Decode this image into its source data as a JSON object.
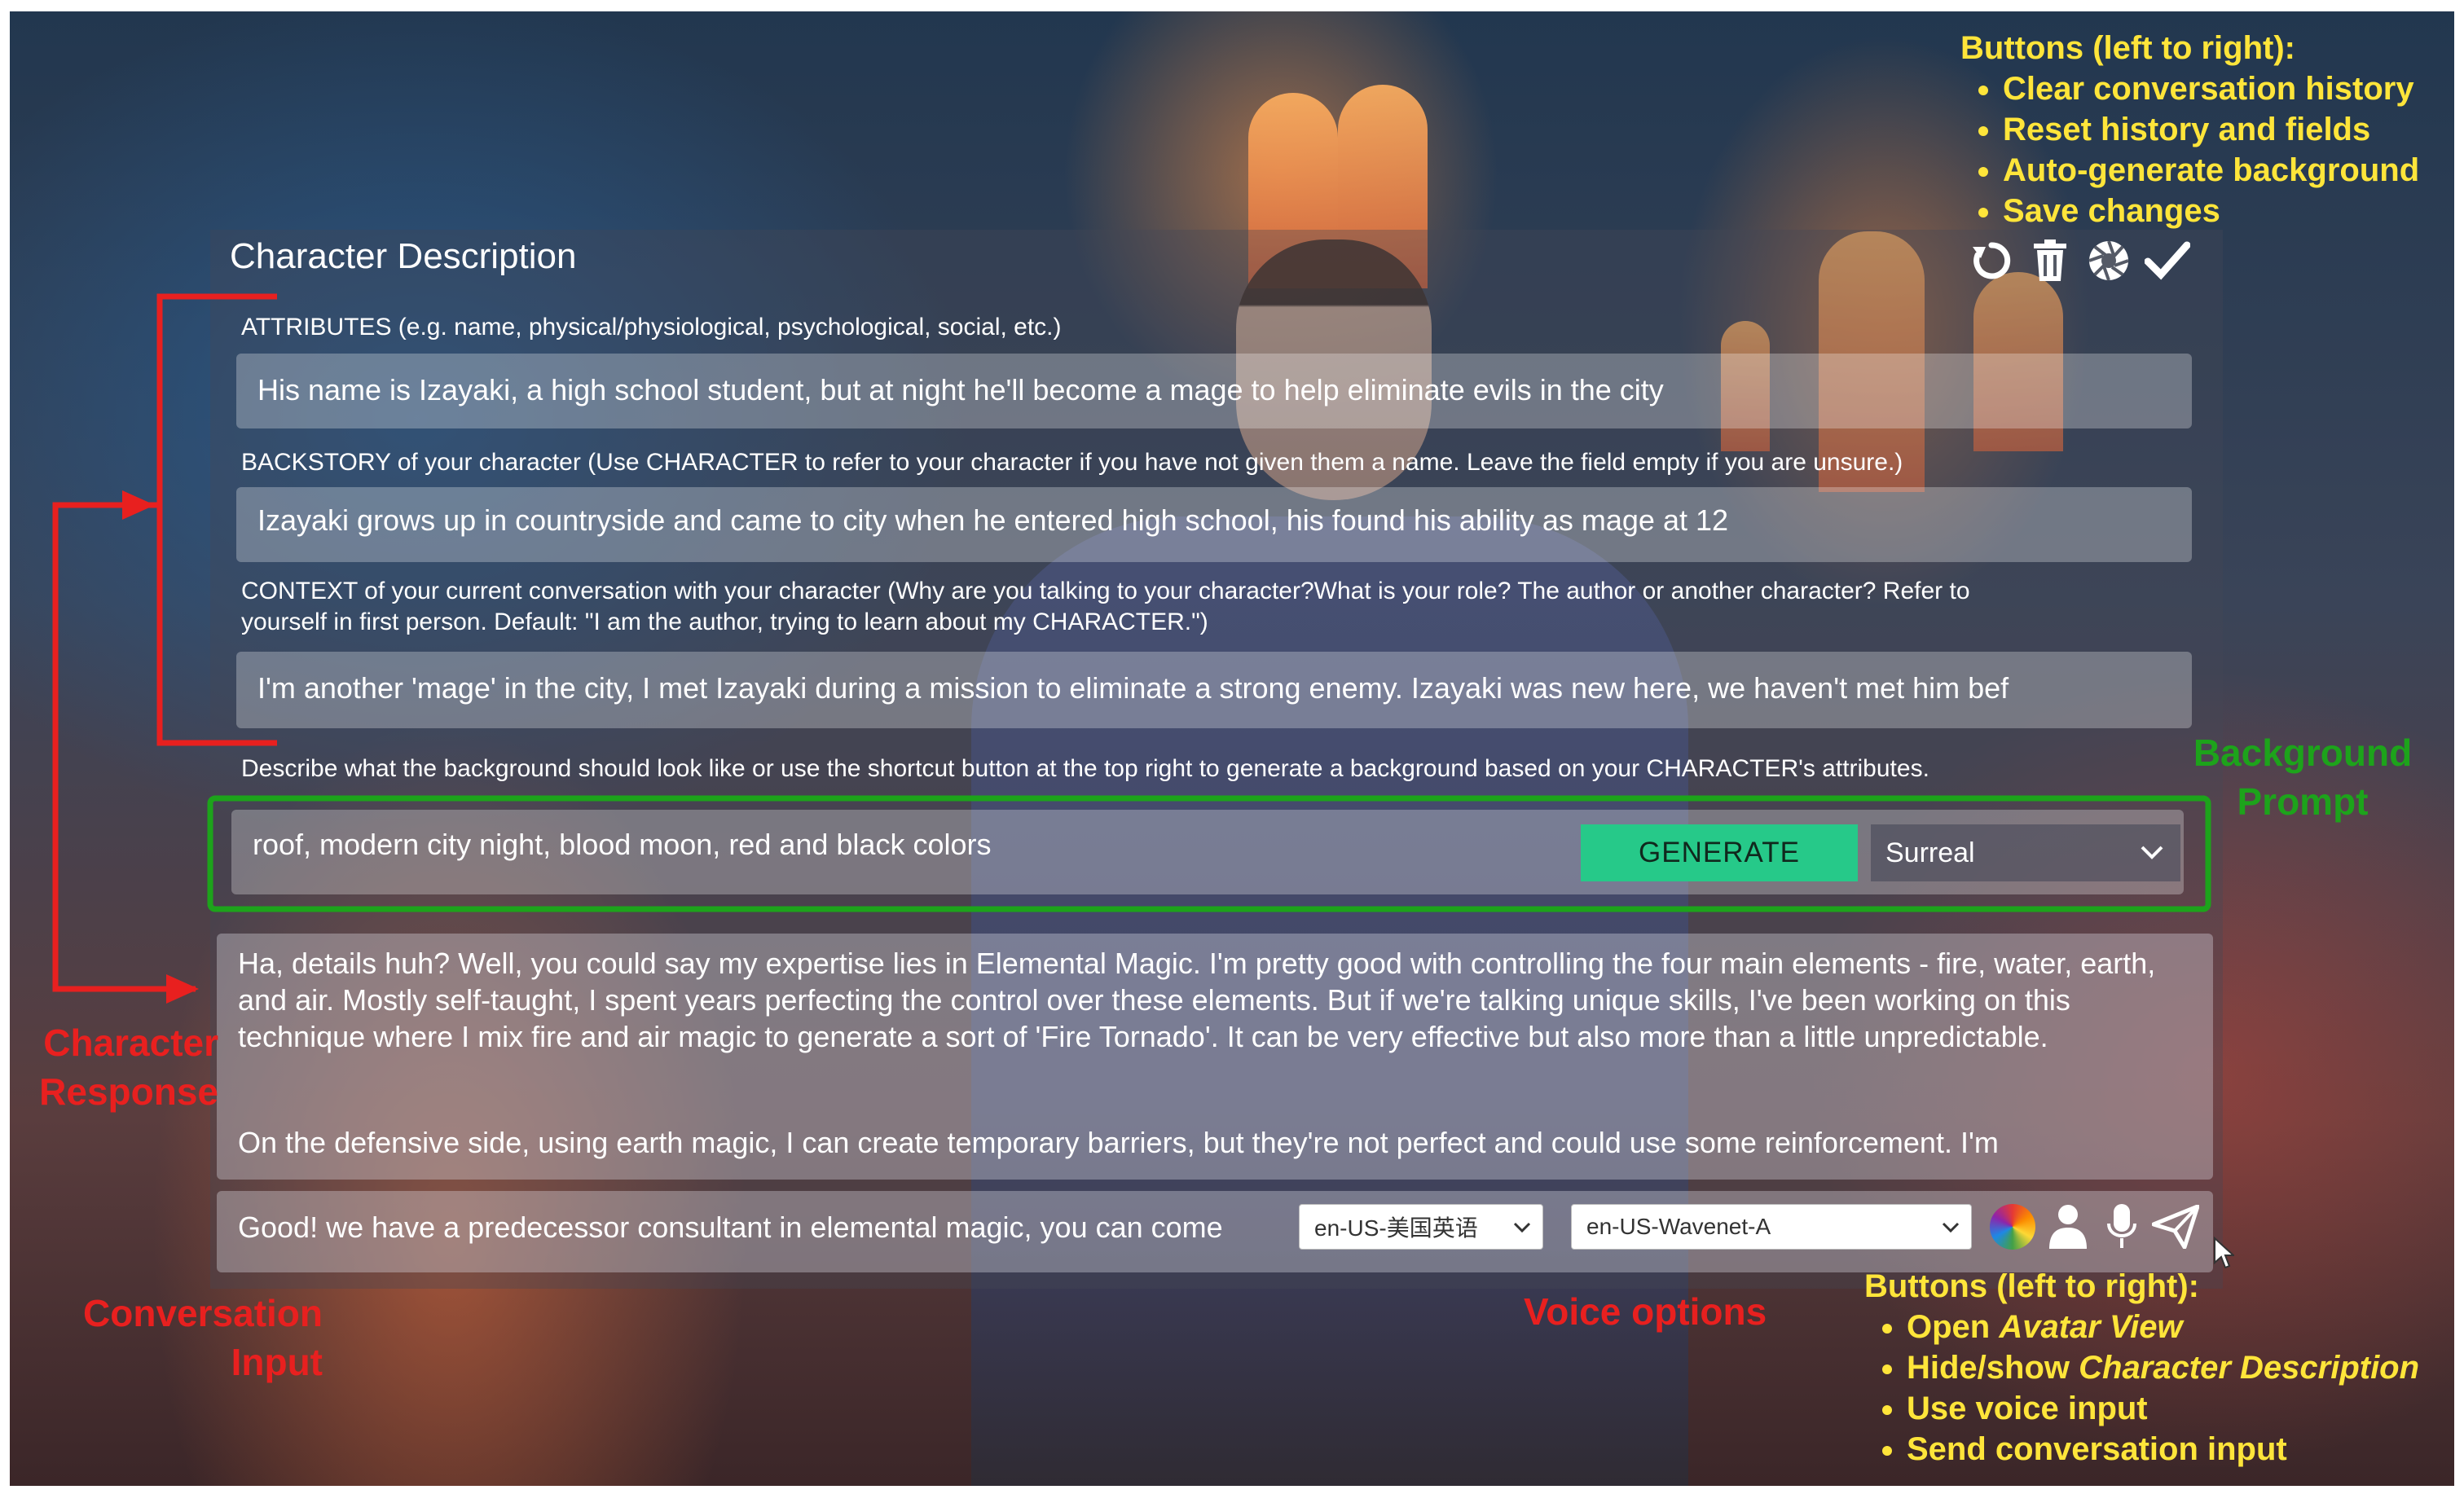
{
  "panel": {
    "title": "Character Description"
  },
  "toolbar": {
    "icons": [
      "clear-conversation-icon",
      "reset-trash-icon",
      "auto-generate-background-icon",
      "save-check-icon"
    ]
  },
  "attributes": {
    "label": "ATTRIBUTES (e.g. name, physical/physiological, psychological, social, etc.)",
    "value": "His name is Izayaki, a high school student, but at night he'll become a mage to help eliminate evils in the city"
  },
  "backstory": {
    "label": "BACKSTORY of your character (Use CHARACTER to refer to your character if you have not given them a name. Leave the field empty if you are unsure.)",
    "value": "Izayaki grows up in countryside and came to city when he entered high school, his found his ability as mage at 12"
  },
  "context": {
    "label_line1": "CONTEXT of your current conversation with your character (Why are you talking to your character?What is your role? The author or another character? Refer to",
    "label_line2": "yourself in first person. Default: \"I am the author, trying to learn about my CHARACTER.\")",
    "value": "I'm another 'mage' in the city, I met Izayaki during a mission to eliminate a strong enemy. Izayaki was new here, we haven't met him bef"
  },
  "background": {
    "label": "Describe what the background should look like or use the shortcut button at the top right to generate a background based on your CHARACTER's attributes.",
    "prompt": "roof, modern city night, blood moon, red and black colors",
    "generate_label": "GENERATE",
    "style_value": "Surreal"
  },
  "response": {
    "paragraph1": "Ha, details huh? Well, you could say my expertise lies in Elemental Magic. I'm pretty good with controlling the four main elements - fire, water, earth, and air. Mostly self-taught, I spent years perfecting the control over these elements. But if we're talking unique skills, I've been working on this technique where I mix fire and air magic to generate a sort of 'Fire Tornado'. It can be very effective but also more than a little unpredictable.",
    "paragraph2": "On the defensive side, using earth magic, I can create temporary barriers, but they're not perfect and could use some reinforcement. I'm"
  },
  "conversation_input": {
    "value": "Good! we have a predecessor consultant in elemental magic, you can come",
    "language_value": "en-US-美国英语",
    "voice_value": "en-US-Wavenet-A",
    "icons": [
      "color-wheel-icon",
      "person-icon",
      "microphone-icon",
      "send-icon"
    ]
  },
  "annotations": {
    "top_buttons": {
      "heading": "Buttons (left to right):",
      "items": [
        "Clear conversation history",
        "Reset history and fields",
        "Auto-generate background",
        "Save changes"
      ]
    },
    "bottom_buttons": {
      "heading": "Buttons (left to right):",
      "items": [
        {
          "prefix": "Open ",
          "emph": "Avatar View"
        },
        {
          "prefix": "Hide/show ",
          "emph": "Character Description"
        },
        {
          "prefix": "Use voice input",
          "emph": ""
        },
        {
          "prefix": "Send conversation input",
          "emph": ""
        }
      ]
    },
    "background_prompt": [
      "Background",
      "Prompt"
    ],
    "character_response": [
      "Character",
      "Response"
    ],
    "conversation_input": [
      "Conversation",
      "Input"
    ],
    "voice_options": "Voice options"
  },
  "colors": {
    "annotation_red": "#e8201f",
    "annotation_green": "#1da31b",
    "annotation_yellow": "#ffe53a",
    "generate_button": "#26c989"
  }
}
